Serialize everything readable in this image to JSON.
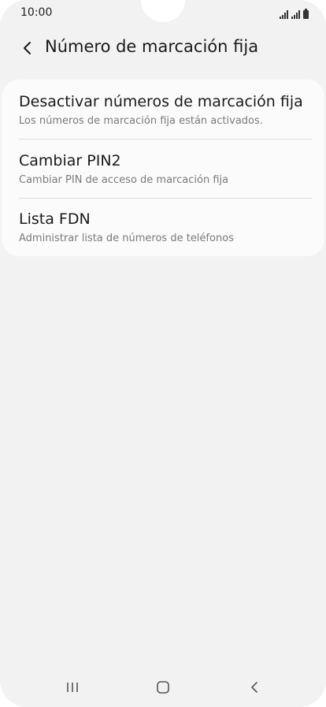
{
  "status_bar": {
    "time": "10:00"
  },
  "header": {
    "back_icon": "chevron-left-icon",
    "title": "Número de marcación fija"
  },
  "settings": {
    "items": [
      {
        "title": "Desactivar números de marcación fija",
        "subtitle": "Los números de marcación fija están activados."
      },
      {
        "title": "Cambiar PIN2",
        "subtitle": "Cambiar PIN de acceso de marcación fija"
      },
      {
        "title": "Lista FDN",
        "subtitle": "Administrar lista de números de teléfonos"
      }
    ]
  },
  "navigation": {
    "recents_icon": "recent-apps-icon",
    "home_icon": "home-icon",
    "back_icon": "back-icon"
  },
  "colors": {
    "background": "#f2f2f2",
    "card": "#fbfbfb",
    "title_text": "#1a1a1a",
    "subtitle_text": "#7a7a7a"
  }
}
